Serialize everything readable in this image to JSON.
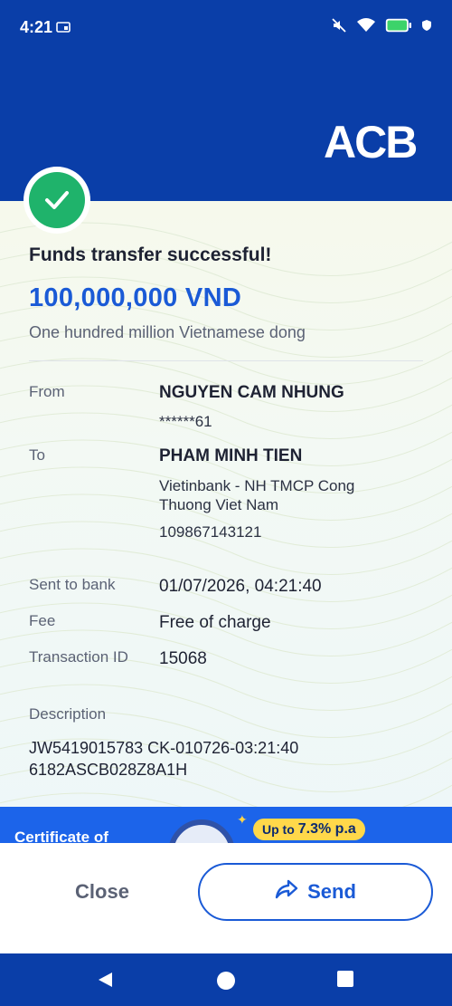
{
  "status_bar": {
    "time": "4:21"
  },
  "brand": {
    "logo_text": "ACB",
    "color_primary": "#0a3ea8",
    "color_accent": "#1a5ad6",
    "color_success": "#1fb36b"
  },
  "receipt": {
    "title": "Funds transfer successful!",
    "amount": "100,000,000 VND",
    "amount_words": "One hundred million Vietnamese dong",
    "from_label": "From",
    "from_name": "NGUYEN CAM NHUNG",
    "from_account": "******61",
    "to_label": "To",
    "to_name": "PHAM MINH TIEN",
    "to_bank_line1": "Vietinbank - NH TMCP Cong",
    "to_bank_line2": "Thuong Viet Nam",
    "to_account": "109867143121",
    "sent_label": "Sent to bank",
    "sent_value": "01/07/2026, 04:21:40",
    "fee_label": "Fee",
    "fee_value": "Free of charge",
    "txn_label": "Transaction ID",
    "txn_value": "15068",
    "desc_label": "Description",
    "desc_line1": "JW5419015783 CK-010726-03:21:40",
    "desc_line2": "6182ASCB028Z8A1H"
  },
  "promo": {
    "text": "Certificate of",
    "pill_prefix": "Up to",
    "pill_rate": "7.3% p.a"
  },
  "actions": {
    "close_label": "Close",
    "send_label": "Send"
  },
  "nav": {
    "back": "back-icon",
    "home": "home-icon",
    "recents": "recents-icon"
  }
}
